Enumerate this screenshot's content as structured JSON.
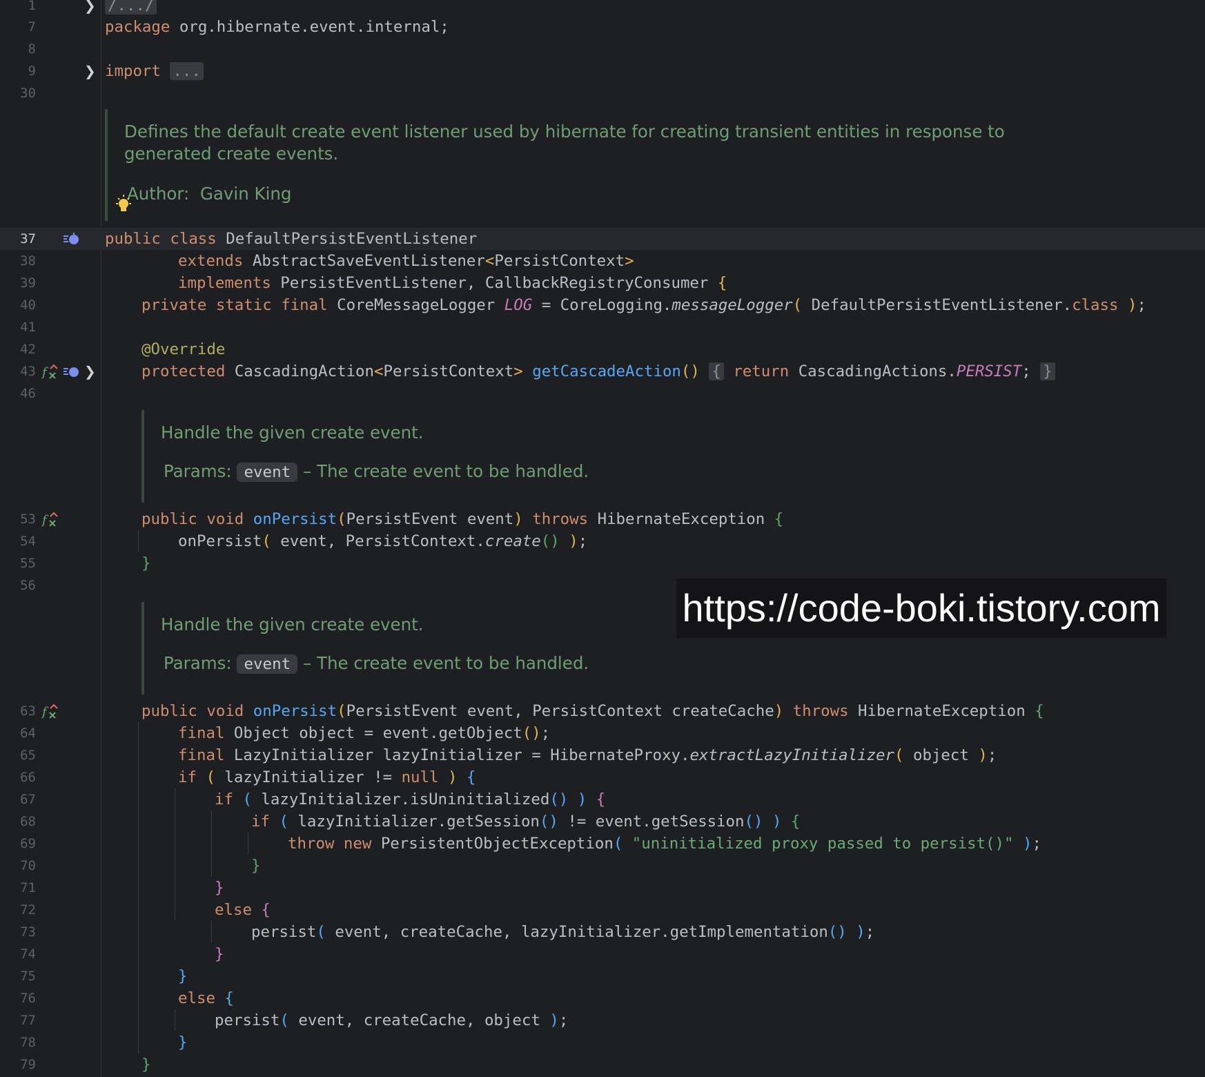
{
  "header_fold": {
    "text": "/.../"
  },
  "package_line": {
    "keyword": "package",
    "name": "org.hibernate.event.internal;"
  },
  "import_line": {
    "keyword": "import",
    "fold": "..."
  },
  "class_doc": {
    "line1": "Defines the default create event listener used by hibernate for creating transient entities in response to",
    "line2": "generated create events.",
    "author_label": "Author:",
    "author_name": "Gavin King"
  },
  "method_doc": {
    "title": "Handle the given create event.",
    "params_label": "Params:",
    "param_name": "event",
    "param_desc": "– The create event to be handled."
  },
  "line_numbers": [
    "1",
    "7",
    "8",
    "9",
    "30",
    "37",
    "38",
    "39",
    "40",
    "41",
    "42",
    "43",
    "46",
    "53",
    "54",
    "55",
    "56",
    "63",
    "64",
    "65",
    "66",
    "67",
    "68",
    "69",
    "70",
    "71",
    "72",
    "73",
    "74",
    "75",
    "76",
    "77",
    "78",
    "79"
  ],
  "code": {
    "l37_kw": "public class",
    "l37_name": "DefaultPersistEventListener",
    "l38_kw": "extends",
    "l38_name": "AbstractSaveEventListener",
    "l38_type": "PersistContext",
    "l39_kw": "implements",
    "l39_name": "PersistEventListener, CallbackRegistryConsumer",
    "l40_kw": "private static final",
    "l40_type": "CoreMessageLogger",
    "l40_const": "LOG",
    "l40_eq": "= CoreLogging.",
    "l40_call": "messageLogger",
    "l40_arg": "DefaultPersistEventListener.",
    "l40_class": "class",
    "l42_annotation": "@Override",
    "l43_kw": "protected",
    "l43_type": "CascadingAction",
    "l43_generic": "PersistContext",
    "l43_fn": "getCascadeAction",
    "l43_return": "return",
    "l43_obj": "CascadingActions.",
    "l43_const": "PERSIST",
    "l53_kw": "public void",
    "l53_fn": "onPersist",
    "l53_params": "PersistEvent event",
    "l53_throws": "throws",
    "l53_exc": "HibernateException",
    "l54_call": "onPersist",
    "l54_args": "event, PersistContext.",
    "l54_create": "create",
    "l63_params": "PersistEvent event, PersistContext createCache",
    "l64_kw": "final",
    "l64_rest": "Object object = event.getObject",
    "l65_kw": "final",
    "l65_rest": "LazyInitializer lazyInitializer = HibernateProxy.",
    "l65_call": "extractLazyInitializer",
    "l65_arg": "object",
    "if": "if",
    "l66_cond": "lazyInitializer != ",
    "null": "null",
    "l67_cond": "lazyInitializer.isUninitialized",
    "l68_cond1": "lazyInitializer.getSession",
    "l68_mid": " != event.getSession",
    "l69_kw": "throw new",
    "l69_cls": "PersistentObjectException",
    "l69_str": "\"uninitialized proxy passed to persist()\"",
    "else": "else",
    "l73_call": "persist",
    "l73_args": "event, createCache, lazyInitializer.getImplementation",
    "l77_args": "event, createCache, object"
  },
  "watermark": "https://code-boki.tistory.com"
}
